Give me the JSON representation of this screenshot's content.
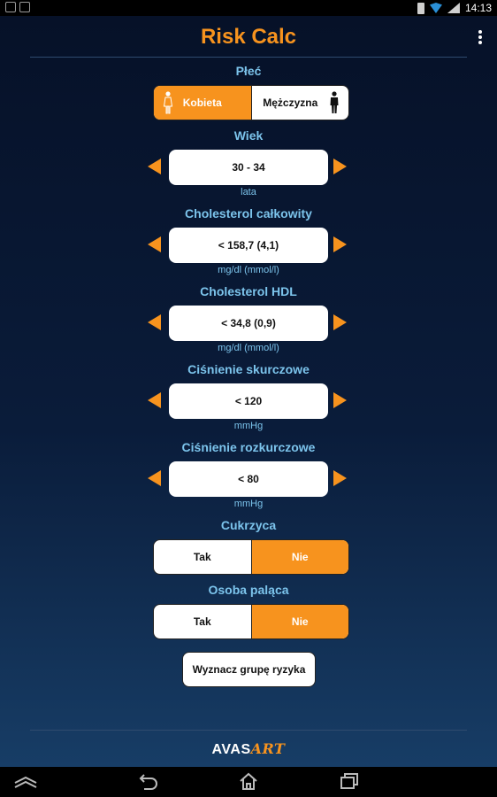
{
  "status_bar": {
    "time": "14:13",
    "icons": [
      "screenshot-icon",
      "android-icon",
      "battery-icon",
      "wifi-icon",
      "signal-icon"
    ]
  },
  "app": {
    "title": "Risk Calc",
    "menu_icon": "overflow-menu-icon"
  },
  "sex": {
    "label": "Płeć",
    "options": [
      "Kobieta",
      "Mężczyzna"
    ],
    "selected": "Kobieta"
  },
  "age": {
    "label": "Wiek",
    "value": "30 - 34",
    "unit": "lata"
  },
  "total_cholesterol": {
    "label": "Cholesterol całkowity",
    "value": "< 158,7 (4,1)",
    "unit": "mg/dl (mmol/l)"
  },
  "hdl_cholesterol": {
    "label": "Cholesterol HDL",
    "value": "< 34,8 (0,9)",
    "unit": "mg/dl (mmol/l)"
  },
  "systolic": {
    "label": "Ciśnienie skurczowe",
    "value": "< 120",
    "unit": "mmHg"
  },
  "diastolic": {
    "label": "Ciśnienie rozkurczowe",
    "value": "< 80",
    "unit": "mmHg"
  },
  "diabetes": {
    "label": "Cukrzyca",
    "options": [
      "Tak",
      "Nie"
    ],
    "selected": "Nie"
  },
  "smoker": {
    "label": "Osoba paląca",
    "options": [
      "Tak",
      "Nie"
    ],
    "selected": "Nie"
  },
  "actions": {
    "calculate_label": "Wyznacz grupę ryzyka"
  },
  "footer": {
    "logo_part1": "AVAS",
    "logo_part2": "ART"
  },
  "colors": {
    "accent": "#f7931e",
    "label": "#7cc4ec",
    "background_top": "#061128",
    "background_bottom": "#173d66"
  }
}
